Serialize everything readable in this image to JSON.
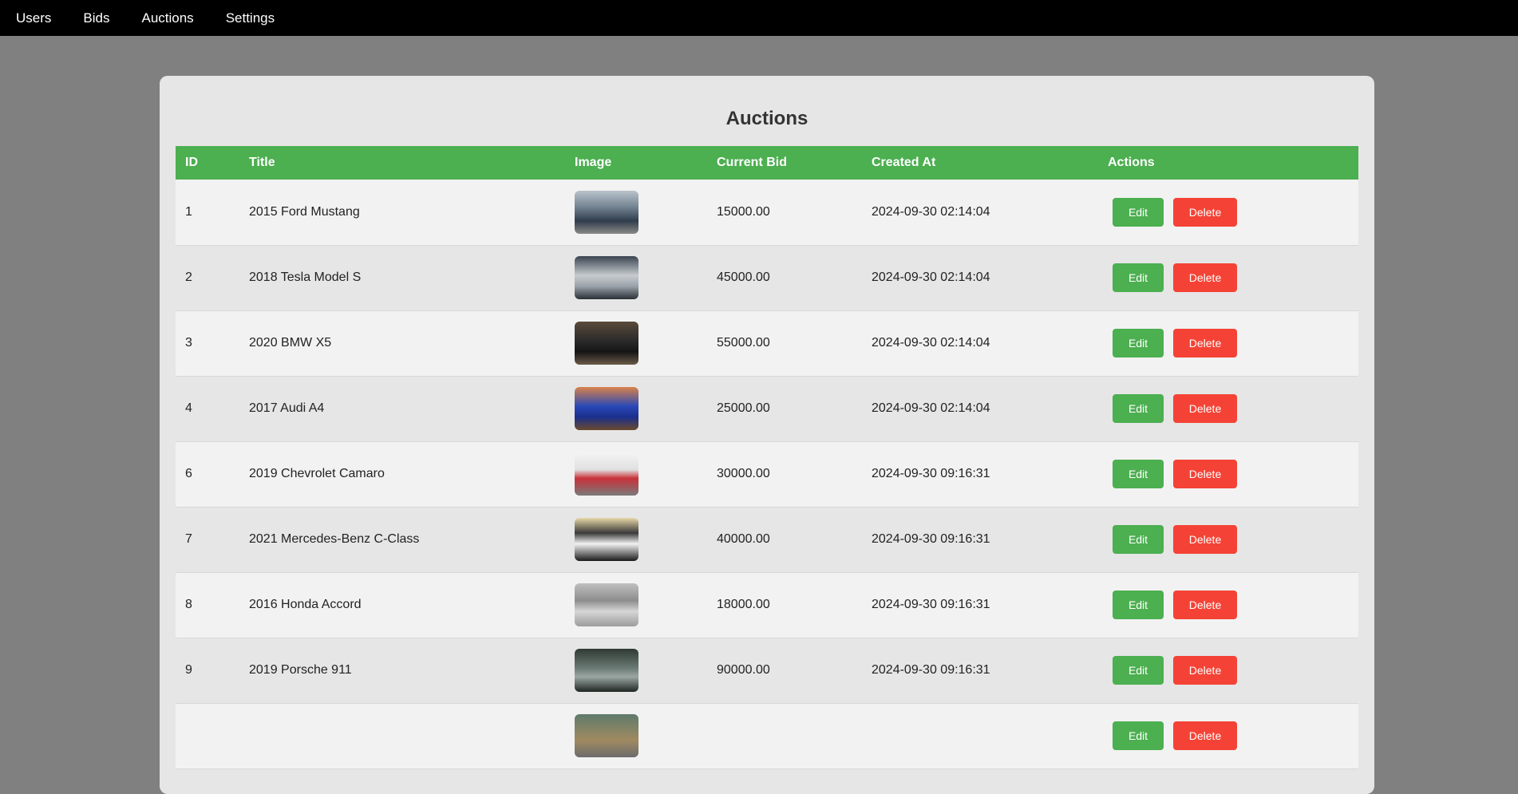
{
  "nav": {
    "items": [
      {
        "label": "Users"
      },
      {
        "label": "Bids"
      },
      {
        "label": "Auctions"
      },
      {
        "label": "Settings"
      }
    ]
  },
  "page": {
    "title": "Auctions"
  },
  "table": {
    "headers": [
      "ID",
      "Title",
      "Image",
      "Current Bid",
      "Created At",
      "Actions"
    ],
    "edit_label": "Edit",
    "delete_label": "Delete",
    "rows": [
      {
        "id": "1",
        "title": "2015 Ford Mustang",
        "current_bid": "15000.00",
        "created_at": "2024-09-30 02:14:04",
        "image": "car-photo-dark-blue-mustang"
      },
      {
        "id": "2",
        "title": "2018 Tesla Model S",
        "current_bid": "45000.00",
        "created_at": "2024-09-30 02:14:04",
        "image": "car-photo-silver-tesla"
      },
      {
        "id": "3",
        "title": "2020 BMW X5",
        "current_bid": "55000.00",
        "created_at": "2024-09-30 02:14:04",
        "image": "car-photo-black-bmw"
      },
      {
        "id": "4",
        "title": "2017 Audi A4",
        "current_bid": "25000.00",
        "created_at": "2024-09-30 02:14:04",
        "image": "car-photo-blue-audi"
      },
      {
        "id": "6",
        "title": "2019 Chevrolet Camaro",
        "current_bid": "30000.00",
        "created_at": "2024-09-30 09:16:31",
        "image": "car-photo-red-camaro"
      },
      {
        "id": "7",
        "title": "2021 Mercedes-Benz C-Class",
        "current_bid": "40000.00",
        "created_at": "2024-09-30 09:16:31",
        "image": "car-photo-white-mercedes-garage"
      },
      {
        "id": "8",
        "title": "2016 Honda Accord",
        "current_bid": "18000.00",
        "created_at": "2024-09-30 09:16:31",
        "image": "car-photo-silver-honda-garage"
      },
      {
        "id": "9",
        "title": "2019 Porsche 911",
        "current_bid": "90000.00",
        "created_at": "2024-09-30 09:16:31",
        "image": "car-photo-grey-porsche"
      },
      {
        "id": "",
        "title": "",
        "current_bid": "",
        "created_at": "",
        "image": "car-photo-partial"
      }
    ]
  },
  "colors": {
    "nav_bg": "#000000",
    "page_bg": "#808080",
    "card_bg": "#e6e6e6",
    "header_bg": "#4caf50",
    "edit_btn": "#4caf50",
    "delete_btn": "#f44336"
  }
}
